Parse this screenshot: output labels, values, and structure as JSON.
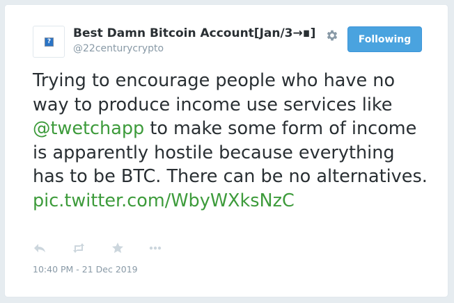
{
  "tweet": {
    "author": {
      "display_name": "Best Damn Bitcoin Account[Jan/3→∎]",
      "handle": "@22centurycrypto",
      "avatar_icon": "broken-image-icon"
    },
    "follow_button_label": "Following",
    "text": {
      "part1": "Trying to encourage people who have no way to produce income use services like ",
      "mention": "@twetchapp",
      "part2": " to make some form of income is apparently hostile because everything has to be BTC. There can be no alternatives. ",
      "media_link": "pic.twitter.com/WbyWXksNzC"
    },
    "actions": [
      "reply-icon",
      "retweet-icon",
      "like-icon",
      "more-icon"
    ],
    "timestamp": "10:40 PM - 21 Dec 2019",
    "colors": {
      "link": "#3d9b3b",
      "button": "#4aa3df",
      "muted": "#8899a6",
      "text": "#292f33"
    }
  }
}
